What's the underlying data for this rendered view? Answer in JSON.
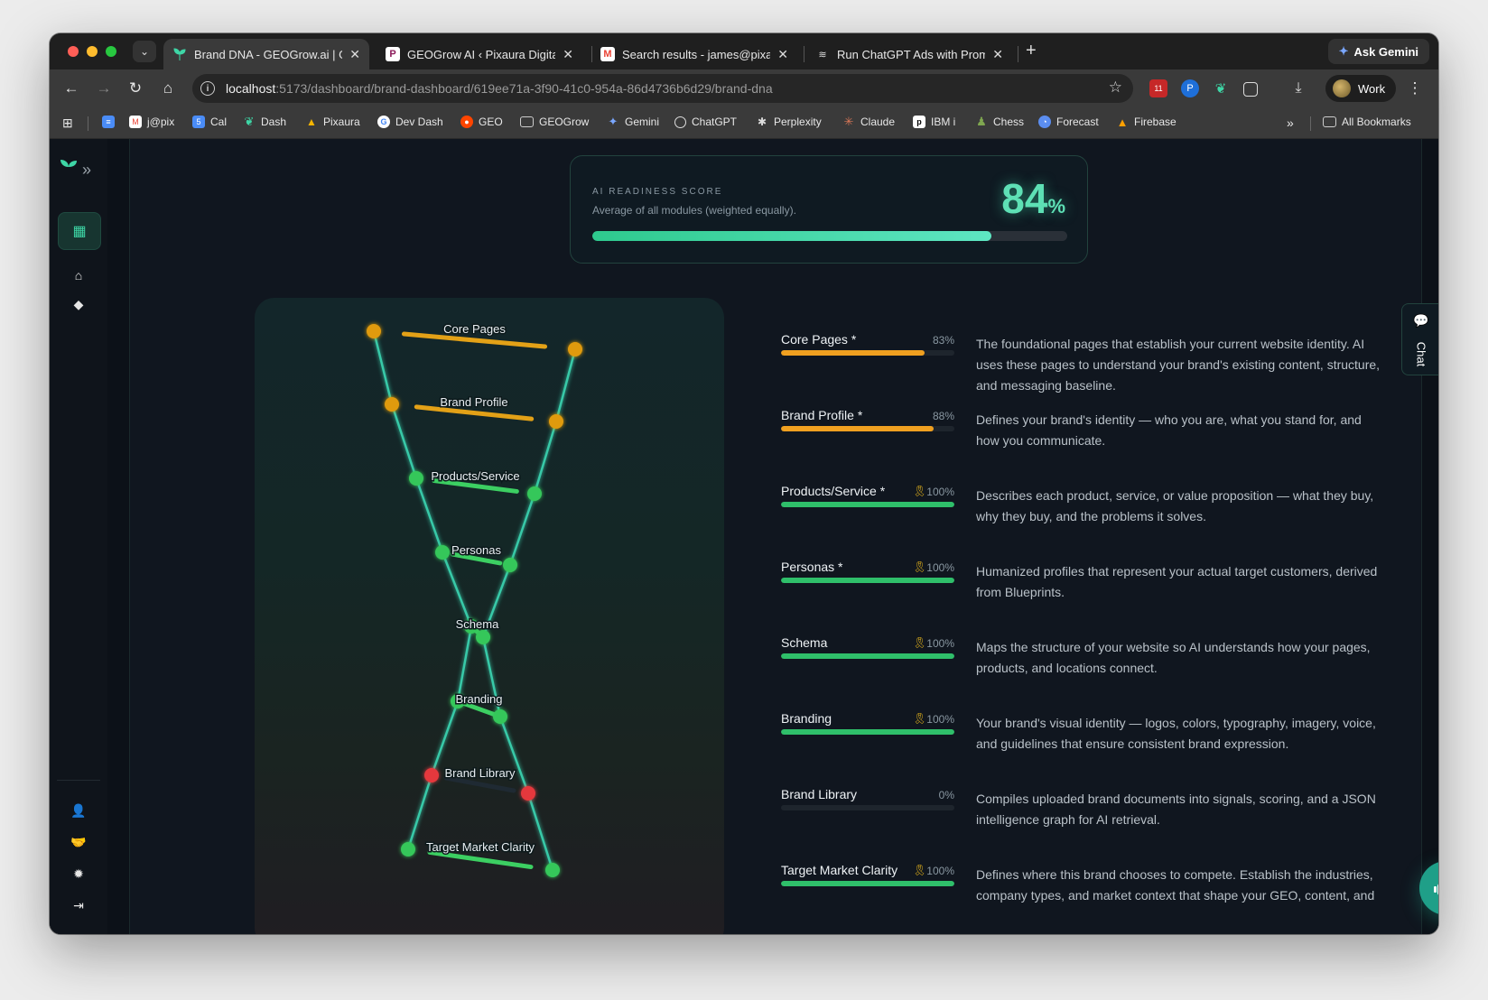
{
  "browser": {
    "tabs": [
      {
        "title": "Brand DNA - GEOGrow.ai | GEOGrow",
        "active": true,
        "icon": "sprout-icon"
      },
      {
        "title": "GEOGrow AI ‹ Pixaura Digital — WordPress",
        "active": false,
        "icon": "pixaura-icon"
      },
      {
        "title": "Search results - james@pixaura.com",
        "active": false,
        "icon": "gmail-icon"
      },
      {
        "title": "Run ChatGPT Ads with Prompt",
        "active": false,
        "icon": "ads-icon"
      }
    ],
    "ask_gemini": "Ask Gemini",
    "url_host": "localhost",
    "url_path": ":5173/dashboard/brand-dashboard/619ee71a-3f90-41c0-954a-86d4736b6d29/brand-dna",
    "profile": "Work",
    "extension_badge": "11",
    "bookmarks": [
      {
        "label": "",
        "icon": "docs-icon",
        "color": "#4a8cf7"
      },
      {
        "label": "j@pix",
        "icon": "gmail-icon",
        "color": "#ea4335"
      },
      {
        "label": "Cal",
        "icon": "calendar-icon",
        "color": "#4a8cf7"
      },
      {
        "label": "Dash",
        "icon": "sprout-icon",
        "color": "#3ed6a6"
      },
      {
        "label": "Pixaura",
        "icon": "drive-icon",
        "color": "#f4b400"
      },
      {
        "label": "Dev Dash",
        "icon": "google-icon",
        "color": "#ffffff"
      },
      {
        "label": "GEO",
        "icon": "reddit-icon",
        "color": "#ff4500"
      },
      {
        "label": "GEOGrow",
        "icon": "folder-icon",
        "color": "#3a3a3a"
      },
      {
        "label": "Gemini",
        "icon": "gemini-icon",
        "color": "#5b8def"
      },
      {
        "label": "ChatGPT",
        "icon": "chatgpt-icon",
        "color": "#ffffff"
      },
      {
        "label": "Perplexity",
        "icon": "perplexity-icon",
        "color": "#ffffff"
      },
      {
        "label": "Claude",
        "icon": "claude-icon",
        "color": "#d97757"
      },
      {
        "label": "IBM i",
        "icon": "ibm-icon",
        "color": "#ffffff"
      },
      {
        "label": "Chess",
        "icon": "chess-icon",
        "color": "#7fa650"
      },
      {
        "label": "Forecast",
        "icon": "forecast-icon",
        "color": "#5b8def"
      },
      {
        "label": "Firebase",
        "icon": "firebase-icon",
        "color": "#ffa000"
      }
    ],
    "all_bookmarks": "All Bookmarks"
  },
  "readiness": {
    "label": "AI READINESS SCORE",
    "subtitle": "Average of all modules (weighted equally).",
    "value": "84",
    "unit": "%",
    "progress": 0.84
  },
  "modules": [
    {
      "name": "Core Pages *",
      "pct": "83%",
      "value": 0.83,
      "medal": false,
      "color": "#f0a020",
      "desc": "The foundational pages that establish your current website identity. AI uses these pages to understand your brand's existing content, structure, and messaging baseline."
    },
    {
      "name": "Brand Profile *",
      "pct": "88%",
      "value": 0.88,
      "medal": false,
      "color": "#f0a020",
      "desc": "Defines your brand's identity — who you are, what you stand for, and how you communicate."
    },
    {
      "name": "Products/Service *",
      "pct": "100%",
      "value": 1.0,
      "medal": true,
      "color": "#2fbf6a",
      "desc": "Describes each product, service, or value proposition — what they buy, why they buy, and the problems it solves."
    },
    {
      "name": "Personas *",
      "pct": "100%",
      "value": 1.0,
      "medal": true,
      "color": "#2fbf6a",
      "desc": "Humanized profiles that represent your actual target customers, derived from Blueprints."
    },
    {
      "name": "Schema",
      "pct": "100%",
      "value": 1.0,
      "medal": true,
      "color": "#2fbf6a",
      "desc": "Maps the structure of your website so AI understands how your pages, products, and locations connect."
    },
    {
      "name": "Branding",
      "pct": "100%",
      "value": 1.0,
      "medal": true,
      "color": "#2fbf6a",
      "desc": "Your brand's visual identity — logos, colors, typography, imagery, voice, and guidelines that ensure consistent brand expression."
    },
    {
      "name": "Brand Library",
      "pct": "0%",
      "value": 0.0,
      "medal": false,
      "color": "#2fbf6a",
      "desc": "Compiles uploaded brand documents into signals, scoring, and a JSON intelligence graph for AI retrieval."
    },
    {
      "name": "Target Market Clarity",
      "pct": "100%",
      "value": 1.0,
      "medal": true,
      "color": "#2fbf6a",
      "desc": "Defines where this brand chooses to compete. Establish the industries, company types, and market context that shape your GEO, content, and"
    }
  ],
  "dna_labels": [
    "Core Pages",
    "Brand Profile",
    "Products/Service",
    "Personas",
    "Schema",
    "Branding",
    "Brand Library",
    "Target Market Clarity"
  ],
  "dna_node_colors": [
    "#e09a10",
    "#e09a10",
    "#35c75a",
    "#35c75a",
    "#35c75a",
    "#35c75a",
    "#e5393e",
    "#35c75a"
  ],
  "chat_tab_label": "Chat"
}
